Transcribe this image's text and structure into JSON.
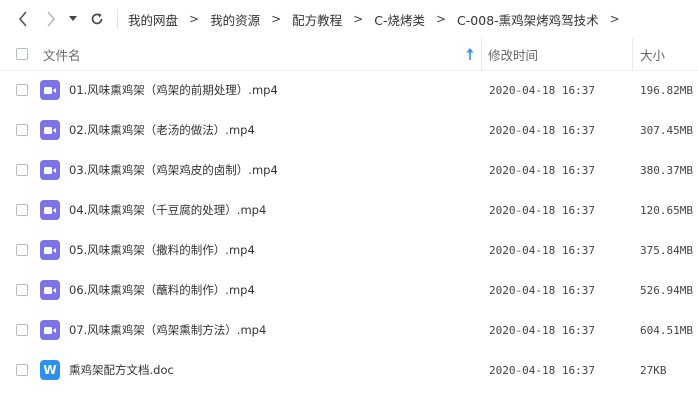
{
  "toolbar": {
    "back_icon": "chevron-left-icon",
    "forward_icon": "chevron-right-icon",
    "dropdown_icon": "caret-down-icon",
    "refresh_icon": "refresh-icon"
  },
  "breadcrumb": {
    "items": [
      "我的网盘",
      "我的资源",
      "配方教程",
      "C-烧烤类",
      "C-008-熏鸡架烤鸡驾技术"
    ],
    "separator": ">"
  },
  "header": {
    "name_label": "文件名",
    "date_label": "修改时间",
    "size_label": "大小",
    "sort_icon": "sort-ascending-icon"
  },
  "colors": {
    "video_icon": "#7c73e6",
    "doc_icon": "#2f8ff0",
    "sort_arrow": "#3a8ee6"
  },
  "files": [
    {
      "name": "01.风味熏鸡架（鸡架的前期处理）.mp4",
      "date": "2020-04-18 16:37",
      "size": "196.82MB",
      "type": "video"
    },
    {
      "name": "02.风味熏鸡架（老汤的做法）.mp4",
      "date": "2020-04-18 16:37",
      "size": "307.45MB",
      "type": "video"
    },
    {
      "name": "03.风味熏鸡架（鸡架鸡皮的卤制）.mp4",
      "date": "2020-04-18 16:37",
      "size": "380.37MB",
      "type": "video"
    },
    {
      "name": "04.风味熏鸡架（千豆腐的处理）.mp4",
      "date": "2020-04-18 16:37",
      "size": "120.65MB",
      "type": "video"
    },
    {
      "name": "05.风味熏鸡架（撒料的制作）.mp4",
      "date": "2020-04-18 16:37",
      "size": "375.84MB",
      "type": "video"
    },
    {
      "name": "06.风味熏鸡架（蘸料的制作）.mp4",
      "date": "2020-04-18 16:37",
      "size": "526.94MB",
      "type": "video"
    },
    {
      "name": "07.风味熏鸡架（鸡架熏制方法）.mp4",
      "date": "2020-04-18 16:37",
      "size": "604.51MB",
      "type": "video"
    },
    {
      "name": "熏鸡架配方文档.doc",
      "date": "2020-04-18 16:37",
      "size": "27KB",
      "type": "doc",
      "icon_letter": "W"
    }
  ]
}
